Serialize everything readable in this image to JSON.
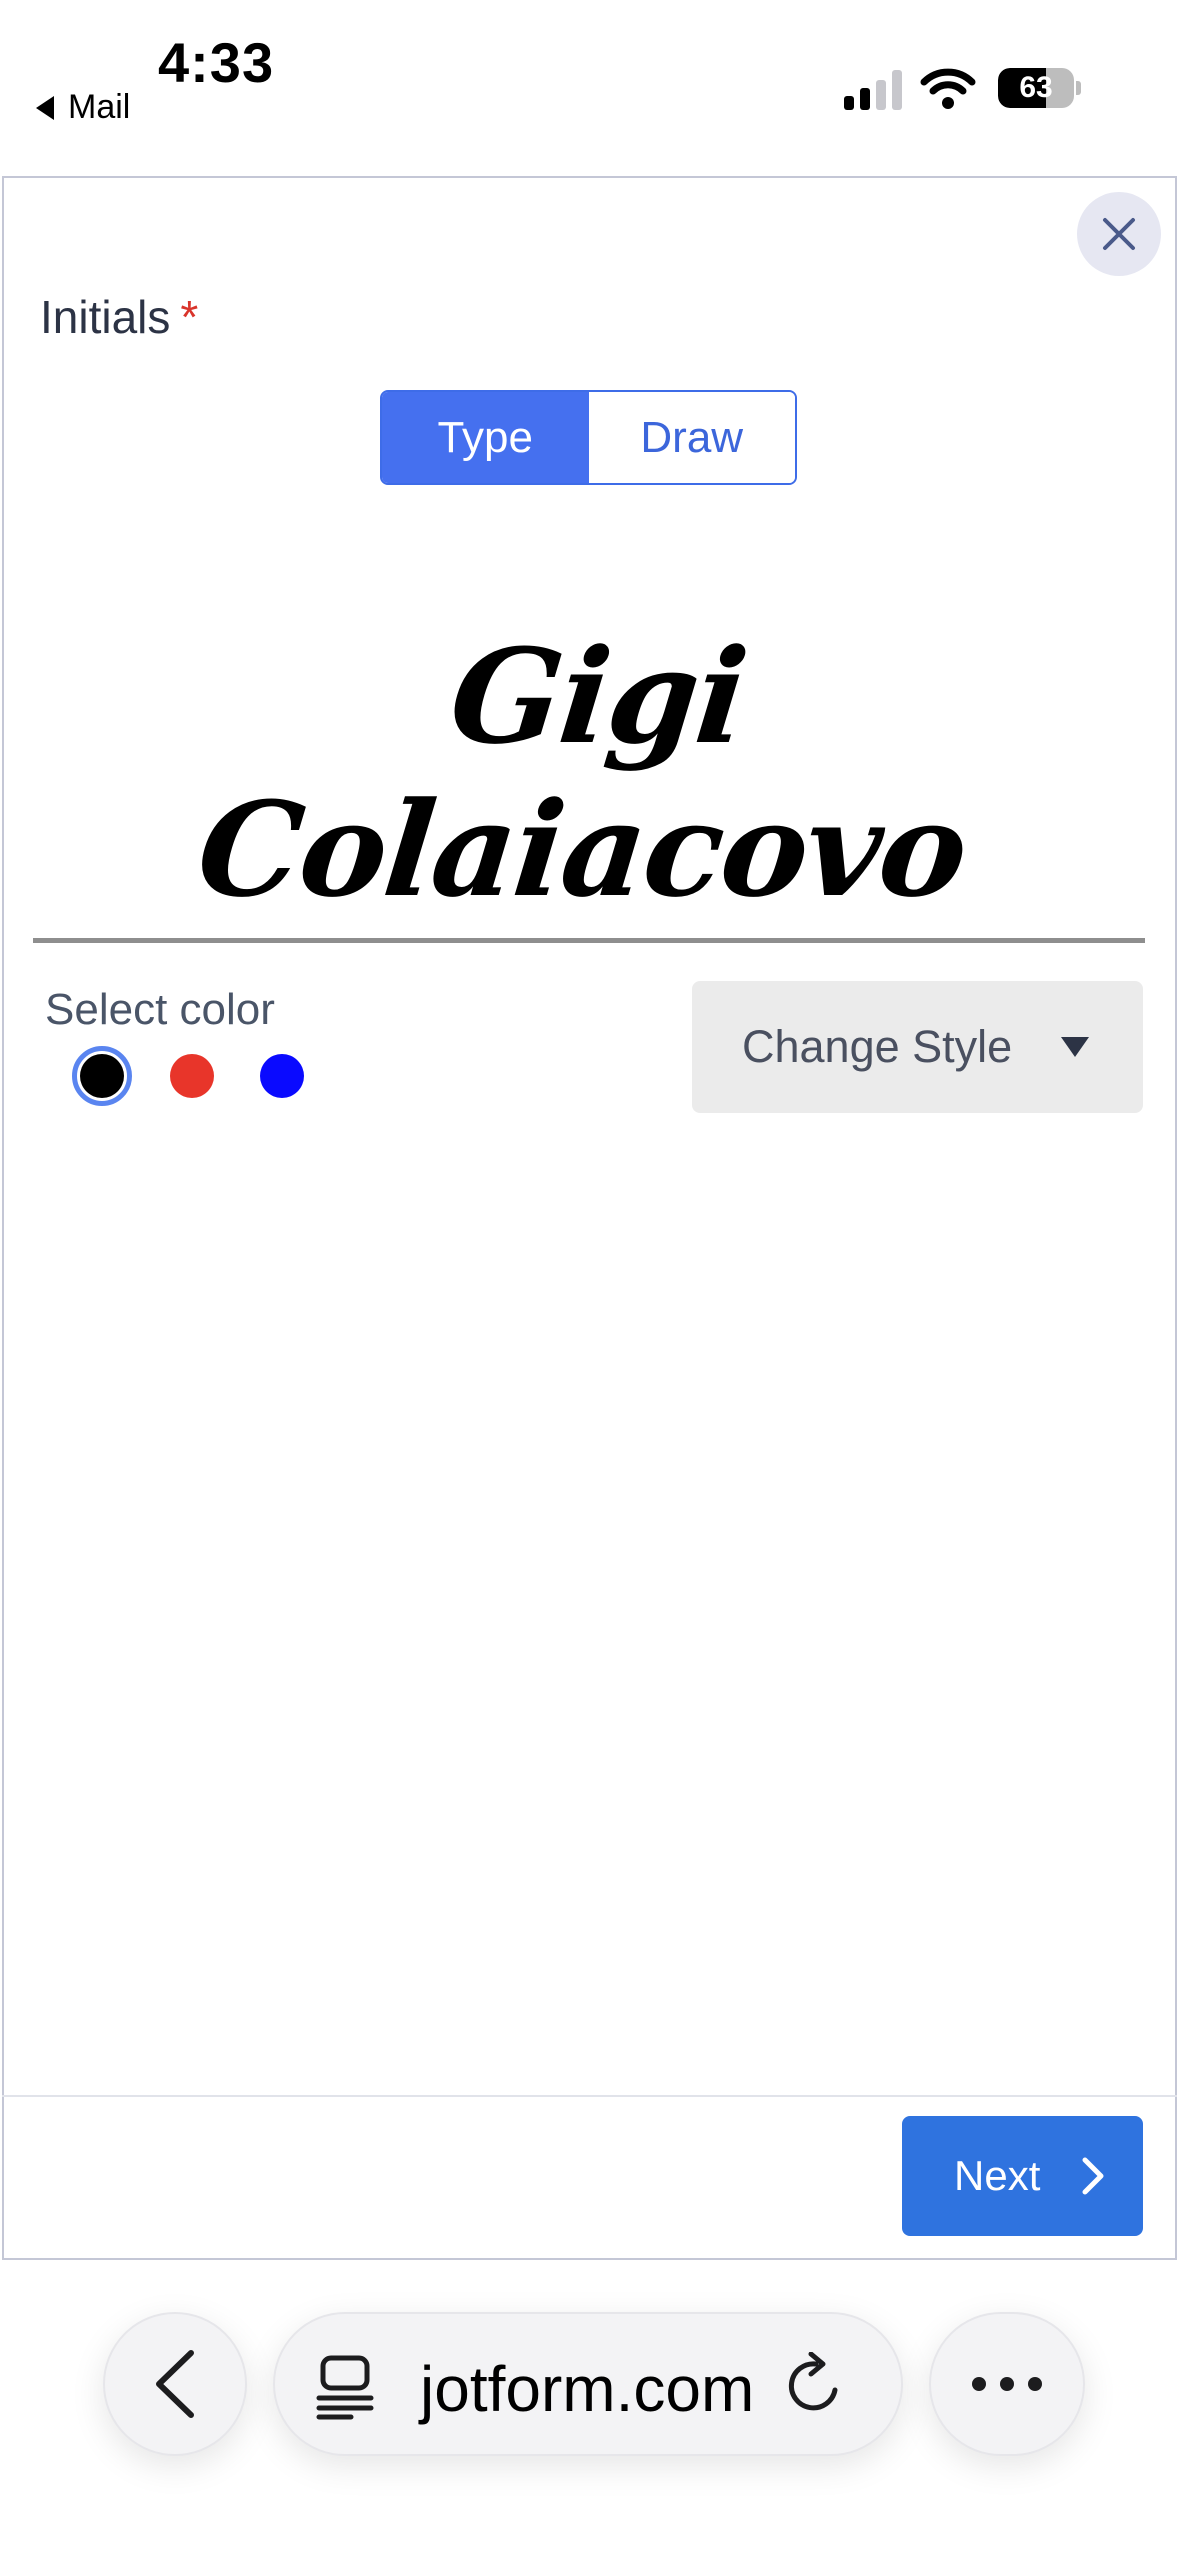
{
  "status_bar": {
    "time": "4:33",
    "back_app": "Mail",
    "battery": "63",
    "battery_level": 0.63
  },
  "form": {
    "field_label": "Initials",
    "required_marker": "*",
    "tabs": [
      {
        "label": "Type",
        "active": true
      },
      {
        "label": "Draw",
        "active": false
      }
    ],
    "signature_text": "Gigi Colaiacovo",
    "select_color_label": "Select color",
    "colors": [
      {
        "name": "black",
        "hex": "#000000",
        "selected": true
      },
      {
        "name": "red",
        "hex": "#e8352a",
        "selected": false
      },
      {
        "name": "blue",
        "hex": "#0a0aff",
        "selected": false
      }
    ],
    "change_style_label": "Change Style",
    "next_label": "Next"
  },
  "browser": {
    "url": "jotform.com",
    "icons": [
      "back-chevron-icon",
      "tabs-icon",
      "reload-icon",
      "more-icon"
    ]
  },
  "theme": {
    "accent": "#4570ef",
    "next_button": "#2f73df",
    "required": "#d9342b"
  }
}
